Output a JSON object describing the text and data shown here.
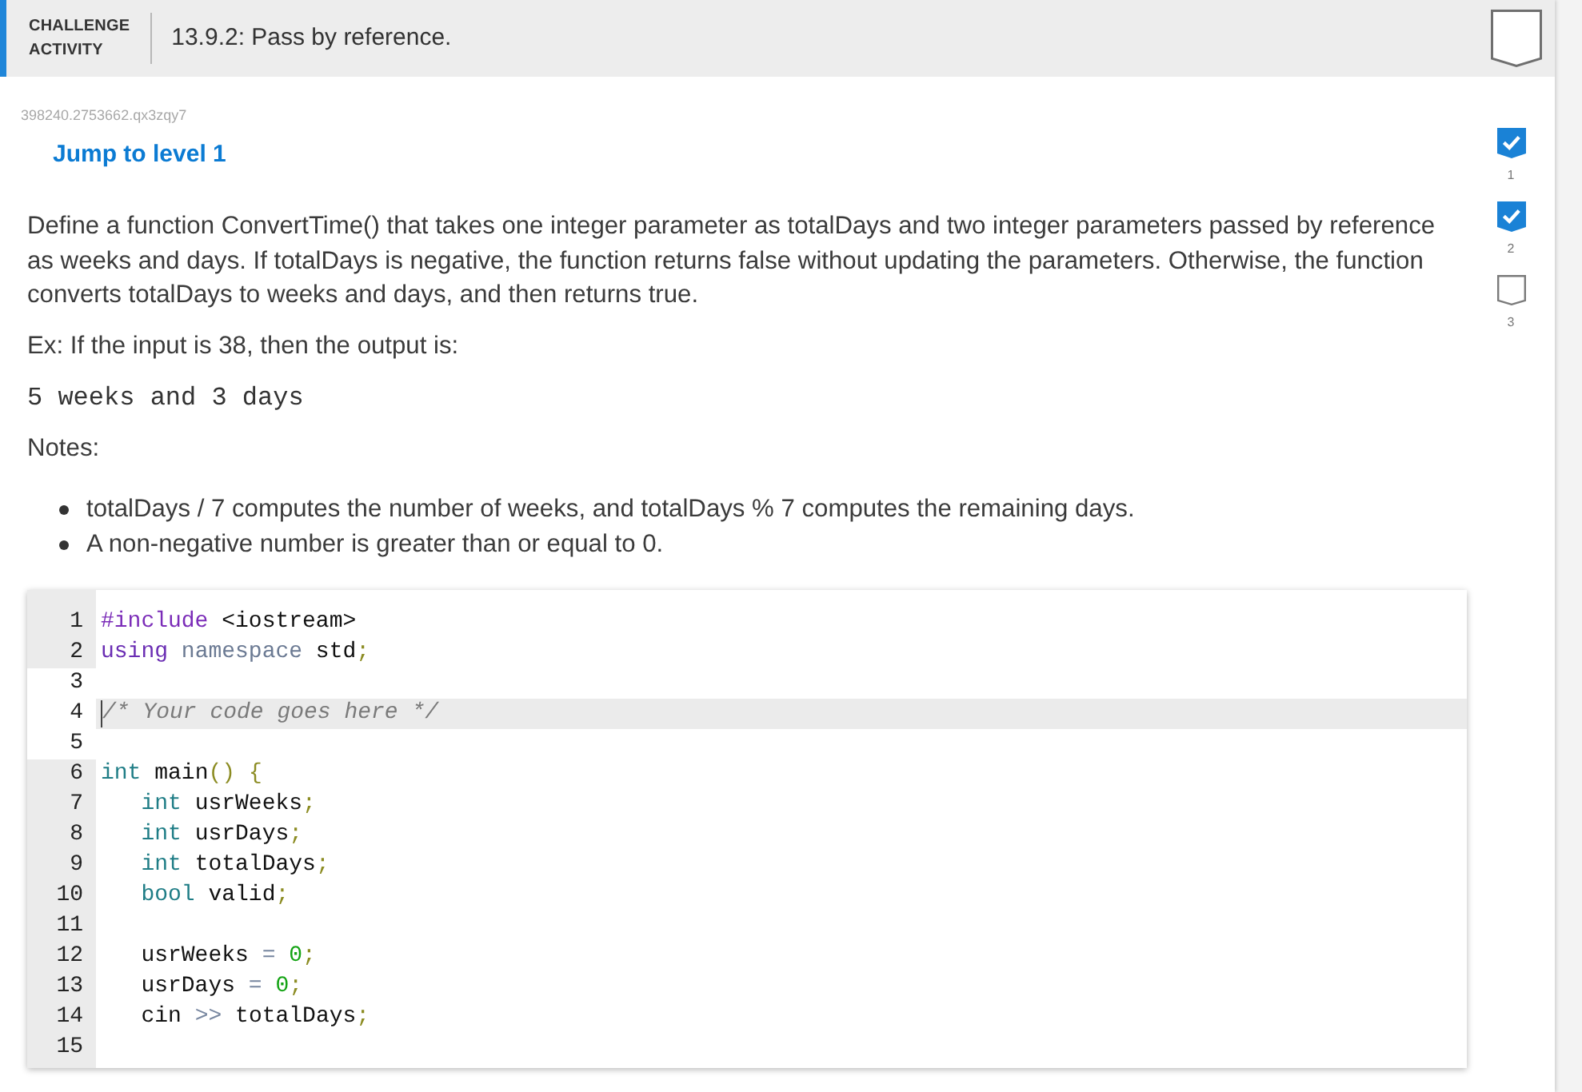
{
  "header": {
    "type_label": "CHALLENGE ACTIVITY",
    "title": "13.9.2: Pass by reference.",
    "completed": false
  },
  "activity_id": "398240.2753662.qx3zqy7",
  "jump_link": "Jump to level 1",
  "levels": [
    {
      "label": "1",
      "completed": true
    },
    {
      "label": "2",
      "completed": true
    },
    {
      "label": "3",
      "completed": false
    }
  ],
  "instructions": {
    "paragraph": "Define a function ConvertTime() that takes one integer parameter as totalDays and two integer parameters passed by reference as weeks and days. If totalDays is negative, the function returns false without updating the parameters. Otherwise, the function converts totalDays to weeks and days, and then returns true.",
    "example_intro": "Ex: If the input is 38, then the output is:",
    "example_output": "5 weeks and 3 days",
    "notes_heading": "Notes:",
    "notes": [
      "totalDays / 7 computes the number of weeks, and totalDays % 7 computes the remaining days.",
      "A non-negative number is greater than or equal to 0."
    ]
  },
  "editor": {
    "lines": [
      {
        "number": "1",
        "editable": false,
        "active": false,
        "indented": false,
        "tokens": [
          {
            "kind": "preprocessor",
            "text": "#include"
          },
          {
            "kind": "plain",
            "text": " <iostream>"
          }
        ]
      },
      {
        "number": "2",
        "editable": false,
        "active": false,
        "indented": false,
        "tokens": [
          {
            "kind": "keyword",
            "text": "using"
          },
          {
            "kind": "builtin",
            "text": " namespace"
          },
          {
            "kind": "plain",
            "text": " std"
          },
          {
            "kind": "punctuation",
            "text": ";"
          }
        ]
      },
      {
        "number": "3",
        "editable": true,
        "active": false
      },
      {
        "number": "4",
        "editable": true,
        "active": true,
        "indented": false,
        "tokens": [
          {
            "kind": "comment",
            "text": "/* Your code goes here */"
          }
        ]
      },
      {
        "number": "5",
        "editable": true,
        "active": false
      },
      {
        "number": "6",
        "editable": false,
        "active": false,
        "indented": false,
        "tokens": [
          {
            "kind": "type",
            "text": "int"
          },
          {
            "kind": "plain",
            "text": " main"
          },
          {
            "kind": "punctuation",
            "text": "()"
          },
          {
            "kind": "punctuation",
            "text": " {"
          }
        ]
      },
      {
        "number": "7",
        "editable": false,
        "active": false,
        "indented": true,
        "tokens": [
          {
            "kind": "type",
            "text": "int"
          },
          {
            "kind": "plain",
            "text": " usrWeeks"
          },
          {
            "kind": "punctuation",
            "text": ";"
          }
        ]
      },
      {
        "number": "8",
        "editable": false,
        "active": false,
        "indented": true,
        "tokens": [
          {
            "kind": "type",
            "text": "int"
          },
          {
            "kind": "plain",
            "text": " usrDays"
          },
          {
            "kind": "punctuation",
            "text": ";"
          }
        ]
      },
      {
        "number": "9",
        "editable": false,
        "active": false,
        "indented": true,
        "tokens": [
          {
            "kind": "type",
            "text": "int"
          },
          {
            "kind": "plain",
            "text": " totalDays"
          },
          {
            "kind": "punctuation",
            "text": ";"
          }
        ]
      },
      {
        "number": "10",
        "editable": false,
        "active": false,
        "indented": true,
        "tokens": [
          {
            "kind": "type",
            "text": "bool"
          },
          {
            "kind": "plain",
            "text": " valid"
          },
          {
            "kind": "punctuation",
            "text": ";"
          }
        ]
      },
      {
        "number": "11",
        "editable": false,
        "active": false
      },
      {
        "number": "12",
        "editable": false,
        "active": false,
        "indented": true,
        "tokens": [
          {
            "kind": "plain",
            "text": "usrWeeks"
          },
          {
            "kind": "operator",
            "text": " ="
          },
          {
            "kind": "number",
            "text": " 0"
          },
          {
            "kind": "punctuation",
            "text": ";"
          }
        ]
      },
      {
        "number": "13",
        "editable": false,
        "active": false,
        "indented": true,
        "tokens": [
          {
            "kind": "plain",
            "text": "usrDays"
          },
          {
            "kind": "operator",
            "text": " ="
          },
          {
            "kind": "number",
            "text": " 0"
          },
          {
            "kind": "punctuation",
            "text": ";"
          }
        ]
      },
      {
        "number": "14",
        "editable": false,
        "active": false,
        "indented": true,
        "tokens": [
          {
            "kind": "plain",
            "text": "cin"
          },
          {
            "kind": "operator",
            "text": " >>"
          },
          {
            "kind": "plain",
            "text": " totalDays"
          },
          {
            "kind": "punctuation",
            "text": ";"
          }
        ]
      },
      {
        "number": "15",
        "editable": false,
        "active": false
      }
    ]
  }
}
